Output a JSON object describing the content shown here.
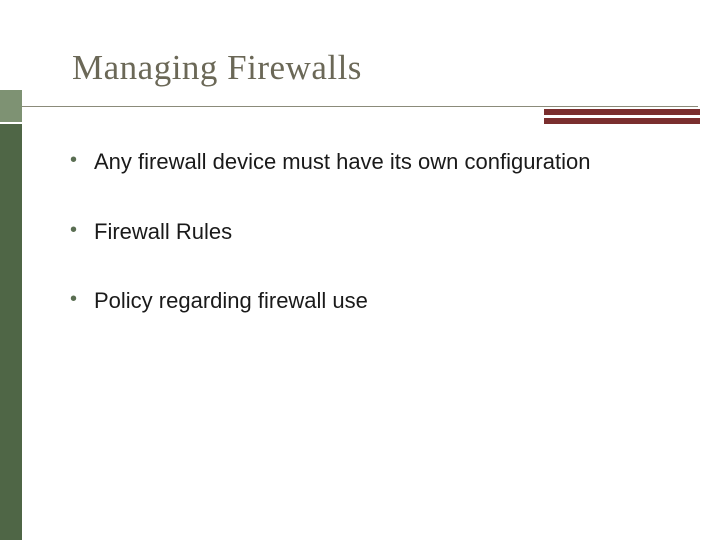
{
  "slide": {
    "title": "Managing Firewalls",
    "bullets": [
      "Any firewall device must have its own configuration",
      "Firewall Rules",
      "Policy regarding firewall use"
    ]
  },
  "colors": {
    "title": "#6b6857",
    "accent": "#7a2e2e",
    "sidebar_light": "#7e9273",
    "sidebar_dark": "#4f6646"
  }
}
